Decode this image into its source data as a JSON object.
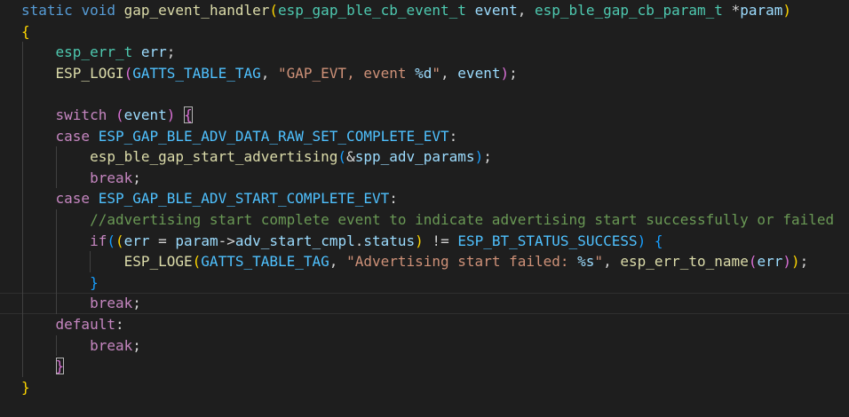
{
  "editor": {
    "language": "c",
    "function_name": "gap_event_handler",
    "lines": [
      [
        [
          "kw",
          "static "
        ],
        [
          "kw",
          "void "
        ],
        [
          "fn",
          "gap_event_handler"
        ],
        [
          "b1",
          "("
        ],
        [
          "ty",
          "esp_gap_ble_cb_event_t "
        ],
        [
          "var",
          "event"
        ],
        [
          "op",
          ", "
        ],
        [
          "ty",
          "esp_ble_gap_cb_param_t "
        ],
        [
          "op",
          "*"
        ],
        [
          "var",
          "param"
        ],
        [
          "b1",
          ")"
        ]
      ],
      [
        [
          "b1",
          "{"
        ]
      ],
      [
        [
          "op",
          "    "
        ],
        [
          "ty",
          "esp_err_t "
        ],
        [
          "var",
          "err"
        ],
        [
          "op",
          ";"
        ]
      ],
      [
        [
          "op",
          "    "
        ],
        [
          "fn",
          "ESP_LOGI"
        ],
        [
          "b2",
          "("
        ],
        [
          "mac",
          "GATTS_TABLE_TAG"
        ],
        [
          "op",
          ", "
        ],
        [
          "str",
          "\"GAP_EVT, event "
        ],
        [
          "fmt",
          "%d"
        ],
        [
          "str",
          "\""
        ],
        [
          "op",
          ", "
        ],
        [
          "var",
          "event"
        ],
        [
          "b2",
          ")"
        ],
        [
          "op",
          ";"
        ]
      ],
      [],
      [
        [
          "op",
          "    "
        ],
        [
          "ctl",
          "switch "
        ],
        [
          "b2",
          "("
        ],
        [
          "var",
          "event"
        ],
        [
          "b2",
          ")"
        ],
        [
          "op",
          " "
        ],
        [
          "b2m",
          "{"
        ]
      ],
      [
        [
          "op",
          "    "
        ],
        [
          "ctl",
          "case "
        ],
        [
          "mac",
          "ESP_GAP_BLE_ADV_DATA_RAW_SET_COMPLETE_EVT"
        ],
        [
          "op",
          ":"
        ]
      ],
      [
        [
          "op",
          "        "
        ],
        [
          "fn",
          "esp_ble_gap_start_advertising"
        ],
        [
          "b3",
          "("
        ],
        [
          "op",
          "&"
        ],
        [
          "var",
          "spp_adv_params"
        ],
        [
          "b3",
          ")"
        ],
        [
          "op",
          ";"
        ]
      ],
      [
        [
          "op",
          "        "
        ],
        [
          "ctl",
          "break"
        ],
        [
          "op",
          ";"
        ]
      ],
      [
        [
          "op",
          "    "
        ],
        [
          "ctl",
          "case "
        ],
        [
          "mac",
          "ESP_GAP_BLE_ADV_START_COMPLETE_EVT"
        ],
        [
          "op",
          ":"
        ]
      ],
      [
        [
          "op",
          "        "
        ],
        [
          "cmt",
          "//advertising start complete event to indicate advertising start successfully or failed"
        ]
      ],
      [
        [
          "op",
          "        "
        ],
        [
          "ctl",
          "if"
        ],
        [
          "b3",
          "("
        ],
        [
          "b1",
          "("
        ],
        [
          "var",
          "err"
        ],
        [
          "op",
          " = "
        ],
        [
          "var",
          "param"
        ],
        [
          "op",
          "->"
        ],
        [
          "var",
          "adv_start_cmpl"
        ],
        [
          "op",
          "."
        ],
        [
          "var",
          "status"
        ],
        [
          "b1",
          ")"
        ],
        [
          "op",
          " != "
        ],
        [
          "mac",
          "ESP_BT_STATUS_SUCCESS"
        ],
        [
          "b3",
          ")"
        ],
        [
          "op",
          " "
        ],
        [
          "b3",
          "{"
        ]
      ],
      [
        [
          "op",
          "            "
        ],
        [
          "fn",
          "ESP_LOGE"
        ],
        [
          "b1",
          "("
        ],
        [
          "mac",
          "GATTS_TABLE_TAG"
        ],
        [
          "op",
          ", "
        ],
        [
          "str",
          "\"Advertising start failed: "
        ],
        [
          "fmt",
          "%s"
        ],
        [
          "str",
          "\""
        ],
        [
          "op",
          ", "
        ],
        [
          "fn",
          "esp_err_to_name"
        ],
        [
          "b2",
          "("
        ],
        [
          "var",
          "err"
        ],
        [
          "b2",
          ")"
        ],
        [
          "b1",
          ")"
        ],
        [
          "op",
          ";"
        ]
      ],
      [
        [
          "op",
          "        "
        ],
        [
          "b3",
          "}"
        ]
      ],
      [
        [
          "op",
          "        "
        ],
        [
          "ctl",
          "break"
        ],
        [
          "op",
          ";"
        ]
      ],
      [
        [
          "op",
          "    "
        ],
        [
          "ctl",
          "default"
        ],
        [
          "op",
          ":"
        ]
      ],
      [
        [
          "op",
          "        "
        ],
        [
          "ctl",
          "break"
        ],
        [
          "op",
          ";"
        ]
      ],
      [
        [
          "op",
          "    "
        ],
        [
          "b2m",
          "}"
        ]
      ],
      [
        [
          "b1",
          "}"
        ]
      ]
    ],
    "current_line_index": 14,
    "indent_guides": [
      [],
      [],
      [
        "g1"
      ],
      [
        "g1"
      ],
      [
        "g1"
      ],
      [
        "g1"
      ],
      [
        "g1"
      ],
      [
        "g1",
        "g2"
      ],
      [
        "g1",
        "g2"
      ],
      [
        "g1"
      ],
      [
        "g1",
        "g2"
      ],
      [
        "g1",
        "g2"
      ],
      [
        "g1",
        "g2",
        "g3"
      ],
      [
        "g1",
        "g2"
      ],
      [
        "g1",
        "g2"
      ],
      [
        "g1"
      ],
      [
        "g1",
        "g2"
      ],
      [
        "g1"
      ],
      []
    ]
  }
}
